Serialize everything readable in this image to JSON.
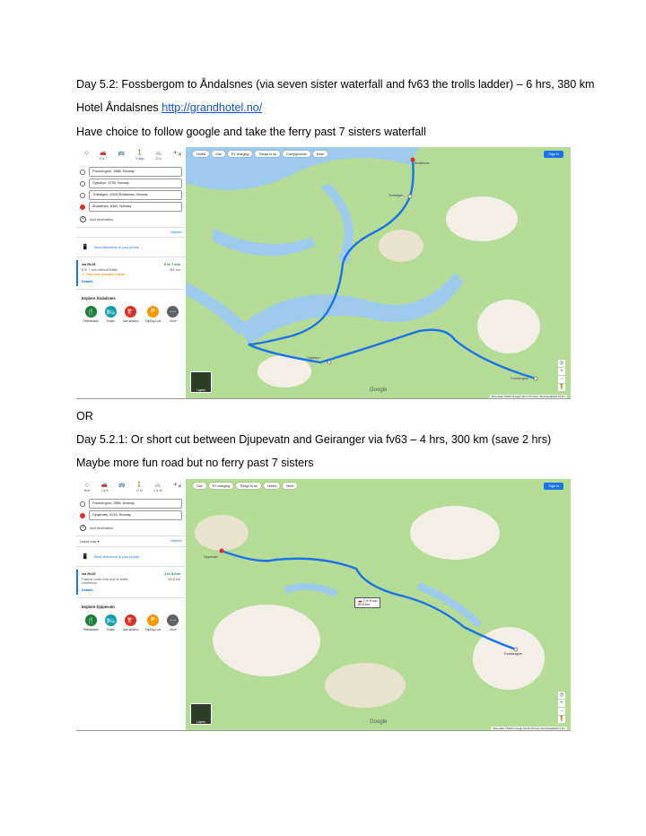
{
  "lines": {
    "day52": "Day 5.2: Fossbergom to Åndalsnes (via seven sister waterfall and fv63 the trolls ladder) – 6 hrs, 380 km",
    "hotel_prefix": "Hotel Åndalsnes ",
    "hotel_link": "http://grandhotel.no/",
    "choice": "Have choice to follow google and take the ferry past 7 sisters waterfall",
    "or": "OR",
    "day521": "Day 5.2.1: Or short cut between Djupevatn and Geiranger via fv63 – 4 hrs, 300 km (save 2 hrs)",
    "maybe": "Maybe more fun road but no ferry past 7 sisters"
  },
  "map1": {
    "modes": [
      {
        "icon": "best-icon",
        "glyph": "◇",
        "label": ""
      },
      {
        "icon": "car-icon",
        "glyph": "🚗",
        "label": "6 hr 7"
      },
      {
        "icon": "transit-icon",
        "glyph": "🚌",
        "label": ""
      },
      {
        "icon": "walk-icon",
        "glyph": "🚶",
        "label": "3 days"
      },
      {
        "icon": "bike-icon",
        "glyph": "🚲",
        "label": "22 hr"
      },
      {
        "icon": "flight-icon",
        "glyph": "✈",
        "label": ""
      }
    ],
    "stops": [
      "Fossbergom, 2686, Norway",
      "Oppstryn, 6799, Norway",
      "Trollstigen, 6300 Åndalsnes, Norway",
      "Åndalsnes, 6300, Norway"
    ],
    "add_destination": "Add destination",
    "options": "Options",
    "send": "Send directions to your phone",
    "route": {
      "name": "via Rv15",
      "time": "6 hr 7 min",
      "dist": "281 km",
      "sub": "6 hr 7 min without traffic",
      "warn": "This route includes a ferry",
      "details": "Details"
    },
    "explore_title": "Explore Åndalsnes",
    "explore": [
      {
        "label": "Restaurants",
        "glyph": "🍴",
        "color": "#188038"
      },
      {
        "label": "Hotels",
        "glyph": "🛏",
        "color": "#129eaf"
      },
      {
        "label": "Gas stations",
        "glyph": "⛽",
        "color": "#d93025"
      },
      {
        "label": "Parking Lots",
        "glyph": "P",
        "color": "#f29900"
      },
      {
        "label": "More",
        "glyph": "⋯",
        "color": "#5f6368"
      }
    ],
    "chips": [
      "Hotels",
      "Gas",
      "EV charging",
      "Things to do",
      "Campgrounds",
      "More"
    ],
    "sign_in": "Sign in",
    "layers": "Layers",
    "google": "Google",
    "footer": "Map data ©2023 Google   Terms   Privacy   Send feedback   10 km",
    "places": [
      {
        "name": "Åndalsnes"
      },
      {
        "name": "Trollstigen"
      },
      {
        "name": "Oppstryn"
      },
      {
        "name": "Fossbergom"
      }
    ]
  },
  "map2": {
    "modes": [
      {
        "icon": "best-icon",
        "glyph": "◇",
        "label": "Best"
      },
      {
        "icon": "car-icon",
        "glyph": "🚗",
        "label": "1 hr 8"
      },
      {
        "icon": "transit-icon",
        "glyph": "🚌",
        "label": ""
      },
      {
        "icon": "walk-icon",
        "glyph": "🚶",
        "label": "17 hr"
      },
      {
        "icon": "bike-icon",
        "glyph": "🚲",
        "label": "4 hr 26"
      },
      {
        "icon": "flight-icon",
        "glyph": "✈",
        "label": ""
      }
    ],
    "stops": [
      "Fossbergom, 2686, Norway",
      "Djupevatn, 6216, Norway"
    ],
    "add_destination": "Add destination",
    "leave_now": "Leave now",
    "options": "Options",
    "send": "Send directions to your phone",
    "route": {
      "name": "via Rv15",
      "time": "1 hr 8 min",
      "dist": "80.6 km",
      "sub": "Fastest route now due to traffic conditions",
      "details": "Details"
    },
    "explore_title": "Explore Djupevatn",
    "explore": [
      {
        "label": "Restaurants",
        "glyph": "🍴",
        "color": "#188038"
      },
      {
        "label": "Hotels",
        "glyph": "🛏",
        "color": "#129eaf"
      },
      {
        "label": "Gas stations",
        "glyph": "⛽",
        "color": "#d93025"
      },
      {
        "label": "Parking Lots",
        "glyph": "P",
        "color": "#f29900"
      },
      {
        "label": "More",
        "glyph": "⋯",
        "color": "#5f6368"
      }
    ],
    "chips": [
      "Gas",
      "EV charging",
      "Things to do",
      "Hotels",
      "More"
    ],
    "sign_in": "Sign in",
    "layers": "Layers",
    "google": "Google",
    "footer": "Map data ©2023 Google   Terms   Privacy   Send feedback   5 km",
    "timebox": "1 hr 8 min",
    "timebox_sub": "80.6 km",
    "places": [
      {
        "name": "Djupevatn"
      },
      {
        "name": "Fossbergom"
      }
    ]
  }
}
